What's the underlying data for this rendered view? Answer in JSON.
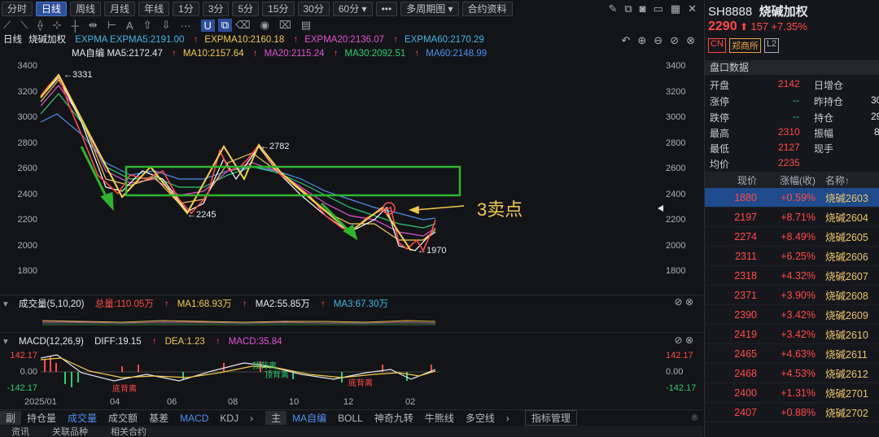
{
  "toolbar": {
    "periods": [
      "分时",
      "日线",
      "周线",
      "月线",
      "年线",
      "1分",
      "3分",
      "5分",
      "15分",
      "30分",
      "60分 ▾",
      "•••",
      "多周期图 ▾",
      "合约资料"
    ],
    "active": "日线"
  },
  "chart_header": {
    "label": "日线",
    "name": "烧碱加权"
  },
  "legend1": {
    "expma5": "EXPMA  EXPMA5:2191.00",
    "expma10": "EXPMA10:2160.18",
    "expma20": "EXPMA20:2136.07",
    "expma60": "EXPMA60:2170.29"
  },
  "legend2": {
    "ma5": "MA自编  MA5:2172.47",
    "ma10": "MA10:2157.64",
    "ma20": "MA20:2115.24",
    "ma30": "MA30:2092.51",
    "ma60": "MA60:2148.99"
  },
  "y_ticks": [
    "3400",
    "3200",
    "3000",
    "2800",
    "2600",
    "2400",
    "2200",
    "2000",
    "1800"
  ],
  "annotations": {
    "high": "3331",
    "mid_high": "2782",
    "low1": "←2245",
    "low2": "←1970",
    "sell": "3卖点"
  },
  "volume": {
    "label": "成交量(5,10,20)",
    "total": "总量:110.05万",
    "ma1": "MA1:68.93万",
    "ma2": "MA2:55.85万",
    "ma3": "MA3:67.30万"
  },
  "macd": {
    "label": "MACD(12,26,9)",
    "diff": "DIFF:19.15",
    "dea": "DEA:1.23",
    "macd": "MACD:35.84",
    "top": "142.17",
    "zero": "0.00",
    "bottom": "-142.17",
    "labels": [
      "顶背离",
      "底背离",
      "顶背离",
      "底背离"
    ]
  },
  "x_labels": [
    "2025/01",
    "04",
    "06",
    "08",
    "10",
    "12",
    "02"
  ],
  "bottom_tabs_left": [
    "副",
    "持仓量",
    "成交量",
    "成交额",
    "基差",
    "MACD",
    "KDJ"
  ],
  "bottom_tabs_right": [
    "主",
    "MA自编",
    "BOLL",
    "神奇九转",
    "牛熊线",
    "多空线"
  ],
  "indicator_btn": "指标管理",
  "bottom_bar": [
    "资讯",
    "关联品种",
    "相关合约"
  ],
  "quote": {
    "code": "SH8888",
    "name": "烧碱加权",
    "price": "2290",
    "change": "157",
    "pct": "+7.35%",
    "tags": [
      "CN",
      "郑商所",
      "L2"
    ]
  },
  "panel": {
    "title": "盘口数据",
    "left": [
      {
        "k": "开盘",
        "v": "2142"
      },
      {
        "k": "涨停",
        "v": "--"
      },
      {
        "k": "跌停",
        "v": "--"
      },
      {
        "k": "最高",
        "v": "2310"
      },
      {
        "k": "最低",
        "v": "2127"
      },
      {
        "k": "均价",
        "v": "2235"
      }
    ],
    "right": [
      {
        "k": "日增仓",
        "v": ""
      },
      {
        "k": "昨持仓",
        "v": "30"
      },
      {
        "k": "持仓",
        "v": "29"
      },
      {
        "k": "振幅",
        "v": "8"
      },
      {
        "k": "现手",
        "v": ""
      }
    ]
  },
  "list": {
    "headers": [
      "现价",
      "涨幅(收)",
      "名称↑"
    ],
    "rows": [
      {
        "price": "1880",
        "pct": "+0.59%",
        "name": "烧碱2603"
      },
      {
        "price": "2197",
        "pct": "+8.71%",
        "name": "烧碱2604"
      },
      {
        "price": "2274",
        "pct": "+8.49%",
        "name": "烧碱2605"
      },
      {
        "price": "2311",
        "pct": "+6.25%",
        "name": "烧碱2606"
      },
      {
        "price": "2318",
        "pct": "+4.32%",
        "name": "烧碱2607"
      },
      {
        "price": "2371",
        "pct": "+3.90%",
        "name": "烧碱2608"
      },
      {
        "price": "2390",
        "pct": "+3.42%",
        "name": "烧碱2609"
      },
      {
        "price": "2419",
        "pct": "+3.42%",
        "name": "烧碱2610"
      },
      {
        "price": "2465",
        "pct": "+4.63%",
        "name": "烧碱2611"
      },
      {
        "price": "2468",
        "pct": "+4.53%",
        "name": "烧碱2612"
      },
      {
        "price": "2400",
        "pct": "+1.31%",
        "name": "烧碱2701"
      },
      {
        "price": "2407",
        "pct": "+0.88%",
        "name": "烧碱2702"
      }
    ]
  },
  "colors": {
    "up": "#ff4a4a",
    "down": "#2ecc71",
    "box": "#2fb52f",
    "accent": "#f2c94c"
  }
}
